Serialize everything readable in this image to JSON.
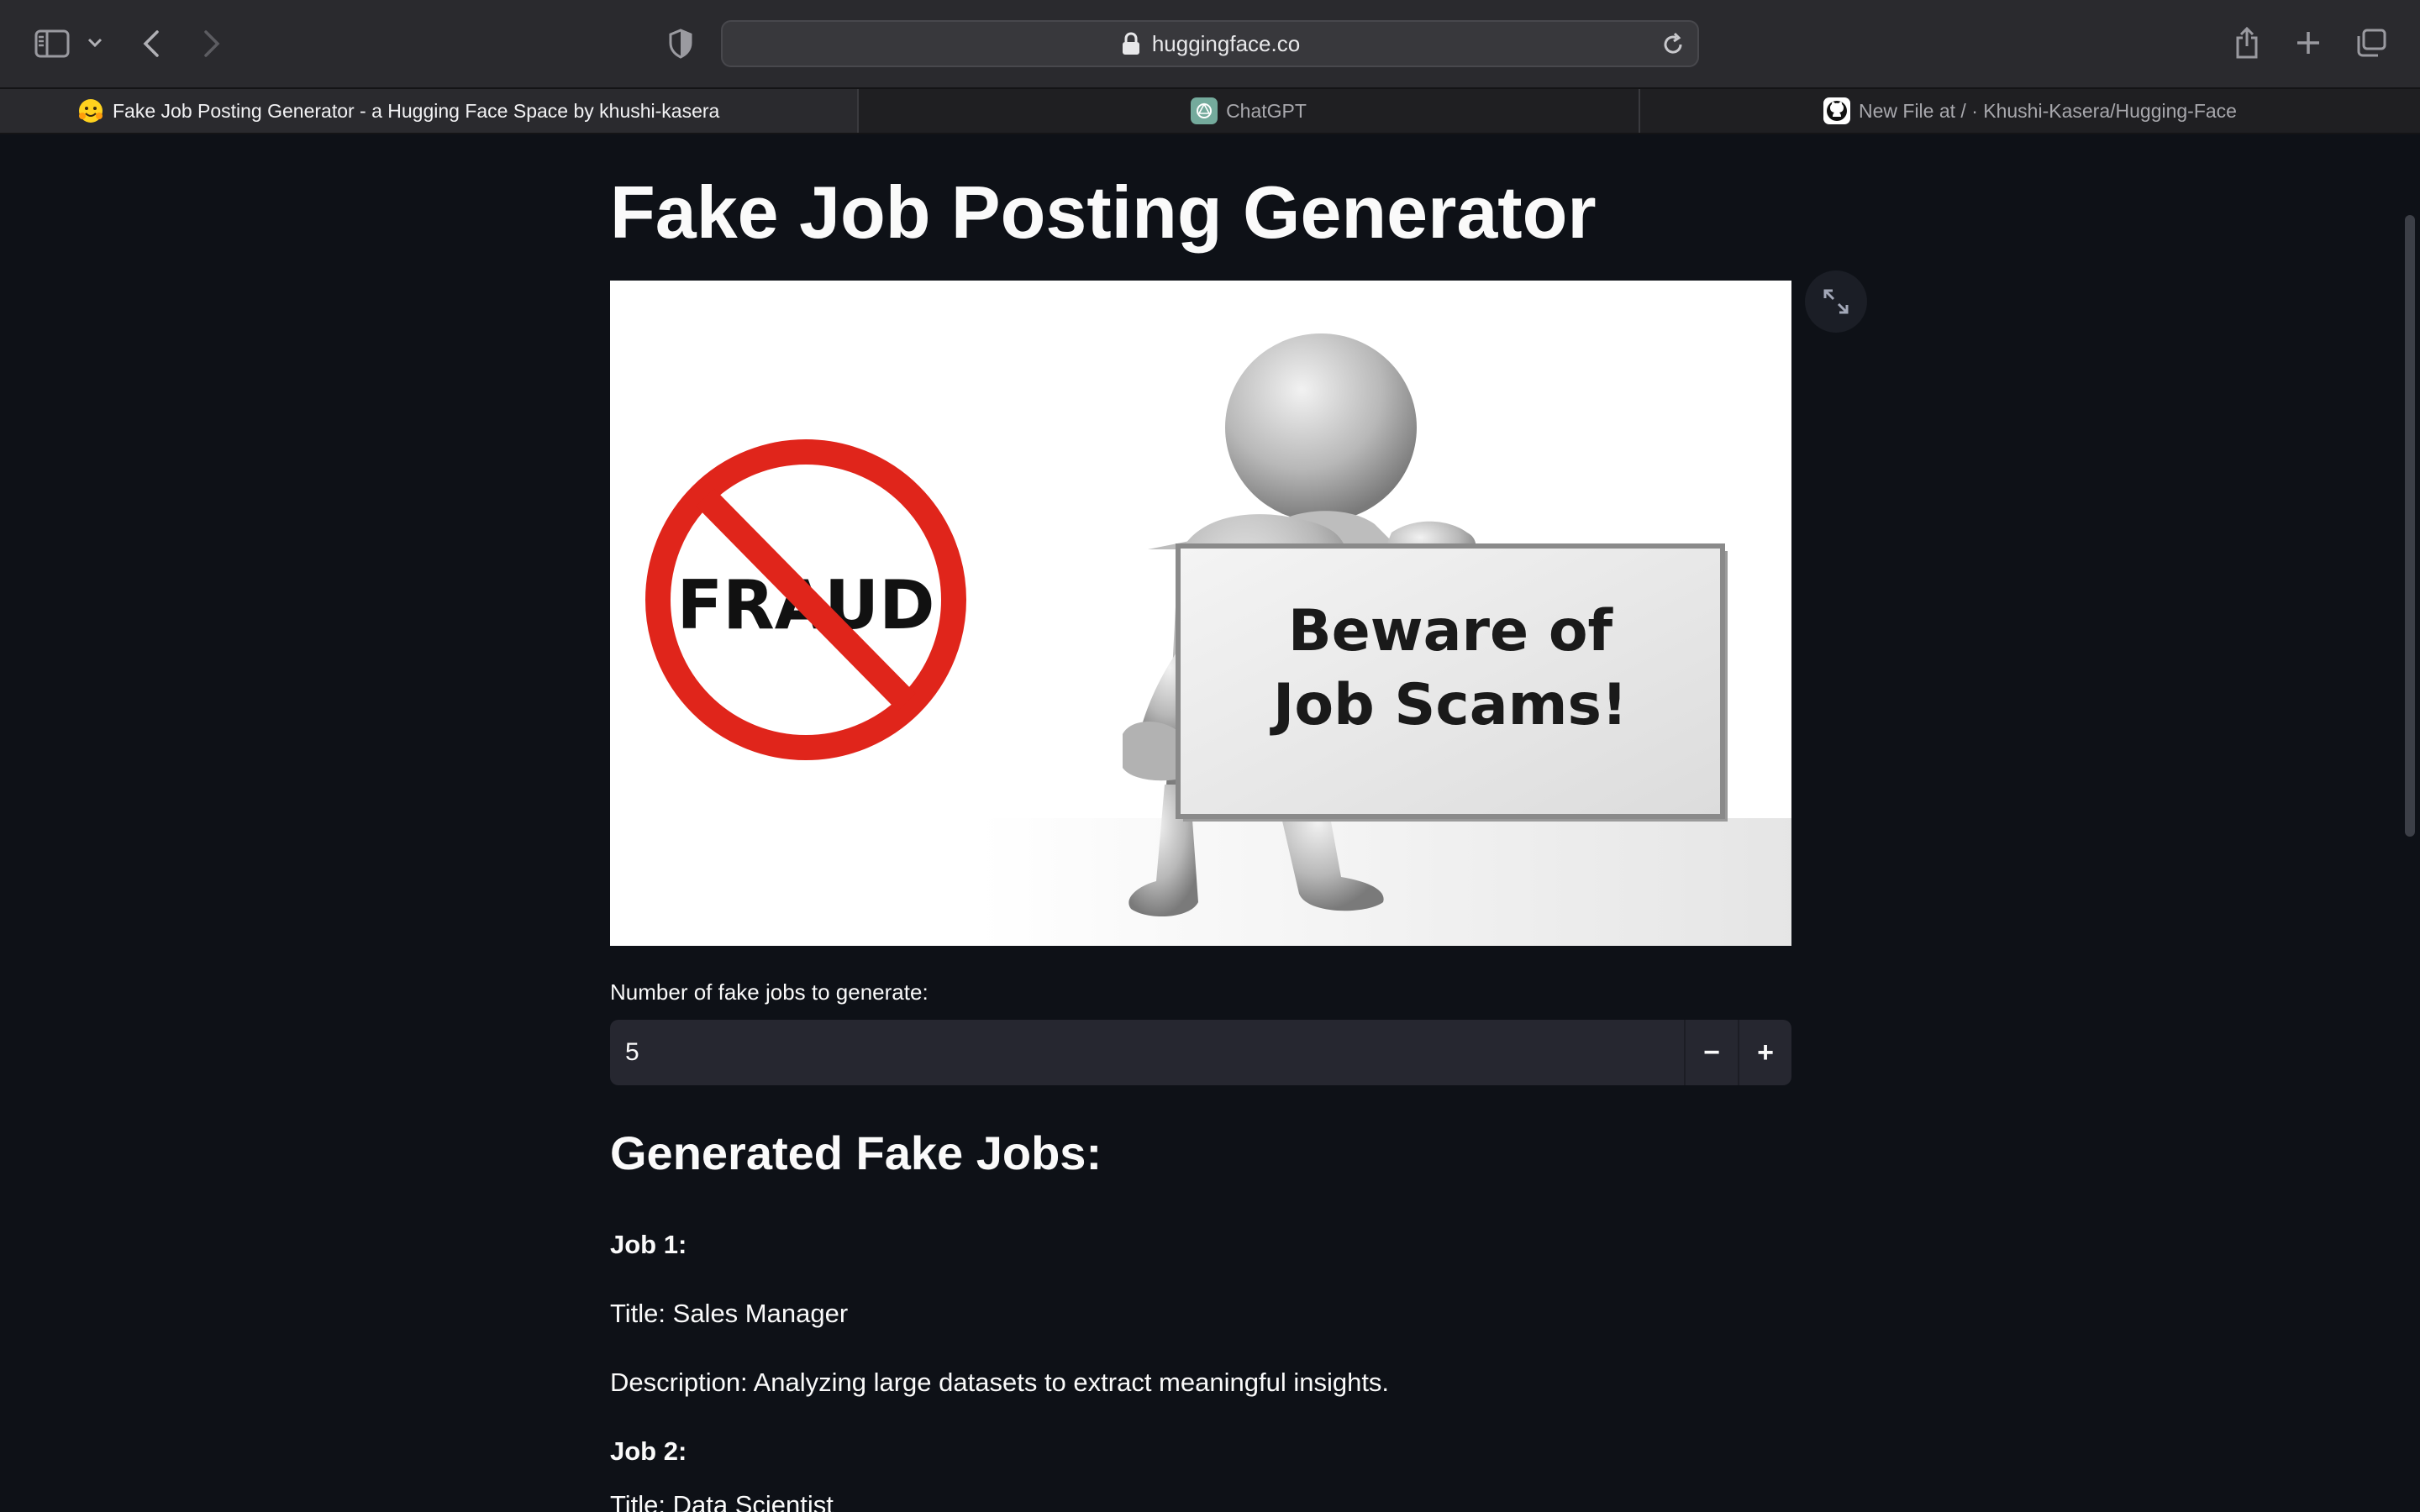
{
  "browser": {
    "url": "huggingface.co",
    "tabs": [
      {
        "label": "Fake Job Posting Generator - a Hugging Face Space by khushi-kasera",
        "active": true,
        "icon": "hugging-face-emoji-icon"
      },
      {
        "label": "ChatGPT",
        "active": false,
        "icon": "chatgpt-icon"
      },
      {
        "label": "New File at / · Khushi-Kasera/Hugging-Face",
        "active": false,
        "icon": "github-icon"
      }
    ]
  },
  "app": {
    "title": "Fake Job Posting Generator",
    "image": {
      "fraud_text": "FRAUD",
      "sign_line1": "Beware of",
      "sign_line2": "Job Scams!"
    },
    "input": {
      "label": "Number of fake jobs to generate:",
      "value": "5",
      "decrement": "−",
      "increment": "+"
    },
    "results": {
      "heading": "Generated Fake Jobs:",
      "job1": {
        "header": "Job 1:",
        "title": "Title: Sales Manager",
        "description": "Description: Analyzing large datasets to extract meaningful insights."
      },
      "job2": {
        "header": "Job 2:",
        "title": "Title: Data Scientist"
      }
    }
  },
  "colors": {
    "page_bg": "#0e1117",
    "input_bg": "#262730",
    "fraud_red": "#e0251b",
    "toolbar_bg": "#2a2a2e"
  }
}
